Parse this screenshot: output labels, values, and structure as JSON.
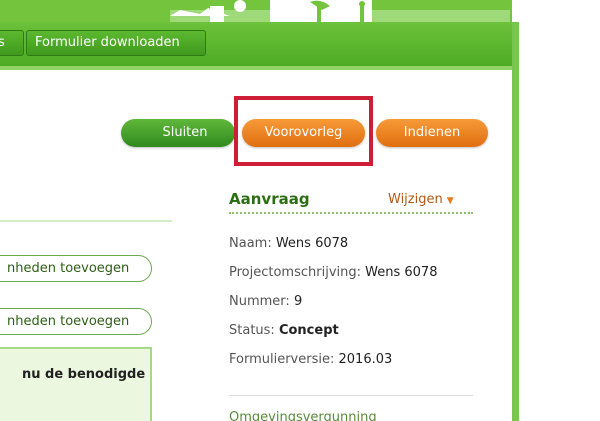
{
  "nav": {
    "tabs": [
      {
        "label": "s"
      },
      {
        "label": "Formulier downloaden"
      }
    ]
  },
  "actions": {
    "close_label": "Sluiten",
    "preview_label": "Voorovorleg",
    "submit_label": "Indienen"
  },
  "left": {
    "button1_label": "nheden toevoegen",
    "button2_label": "nheden toevoegen",
    "info_text": "nu de benodigde"
  },
  "panel": {
    "title": "Aanvraag",
    "edit_label": "Wijzigen",
    "fields": [
      {
        "label": "Naam:",
        "value": "Wens 6078"
      },
      {
        "label": "Projectomschrijving:",
        "value": "Wens 6078"
      },
      {
        "label": "Nummer:",
        "value": "9"
      },
      {
        "label": "Status:",
        "value": "Concept"
      },
      {
        "label": "Formulierversie:",
        "value": "2016.03"
      }
    ],
    "next_section_partial": "Omgevingsvergunning"
  },
  "colors": {
    "brand_green": "#5fb83a",
    "action_orange": "#f08628",
    "highlight_red": "#cc1f35"
  }
}
